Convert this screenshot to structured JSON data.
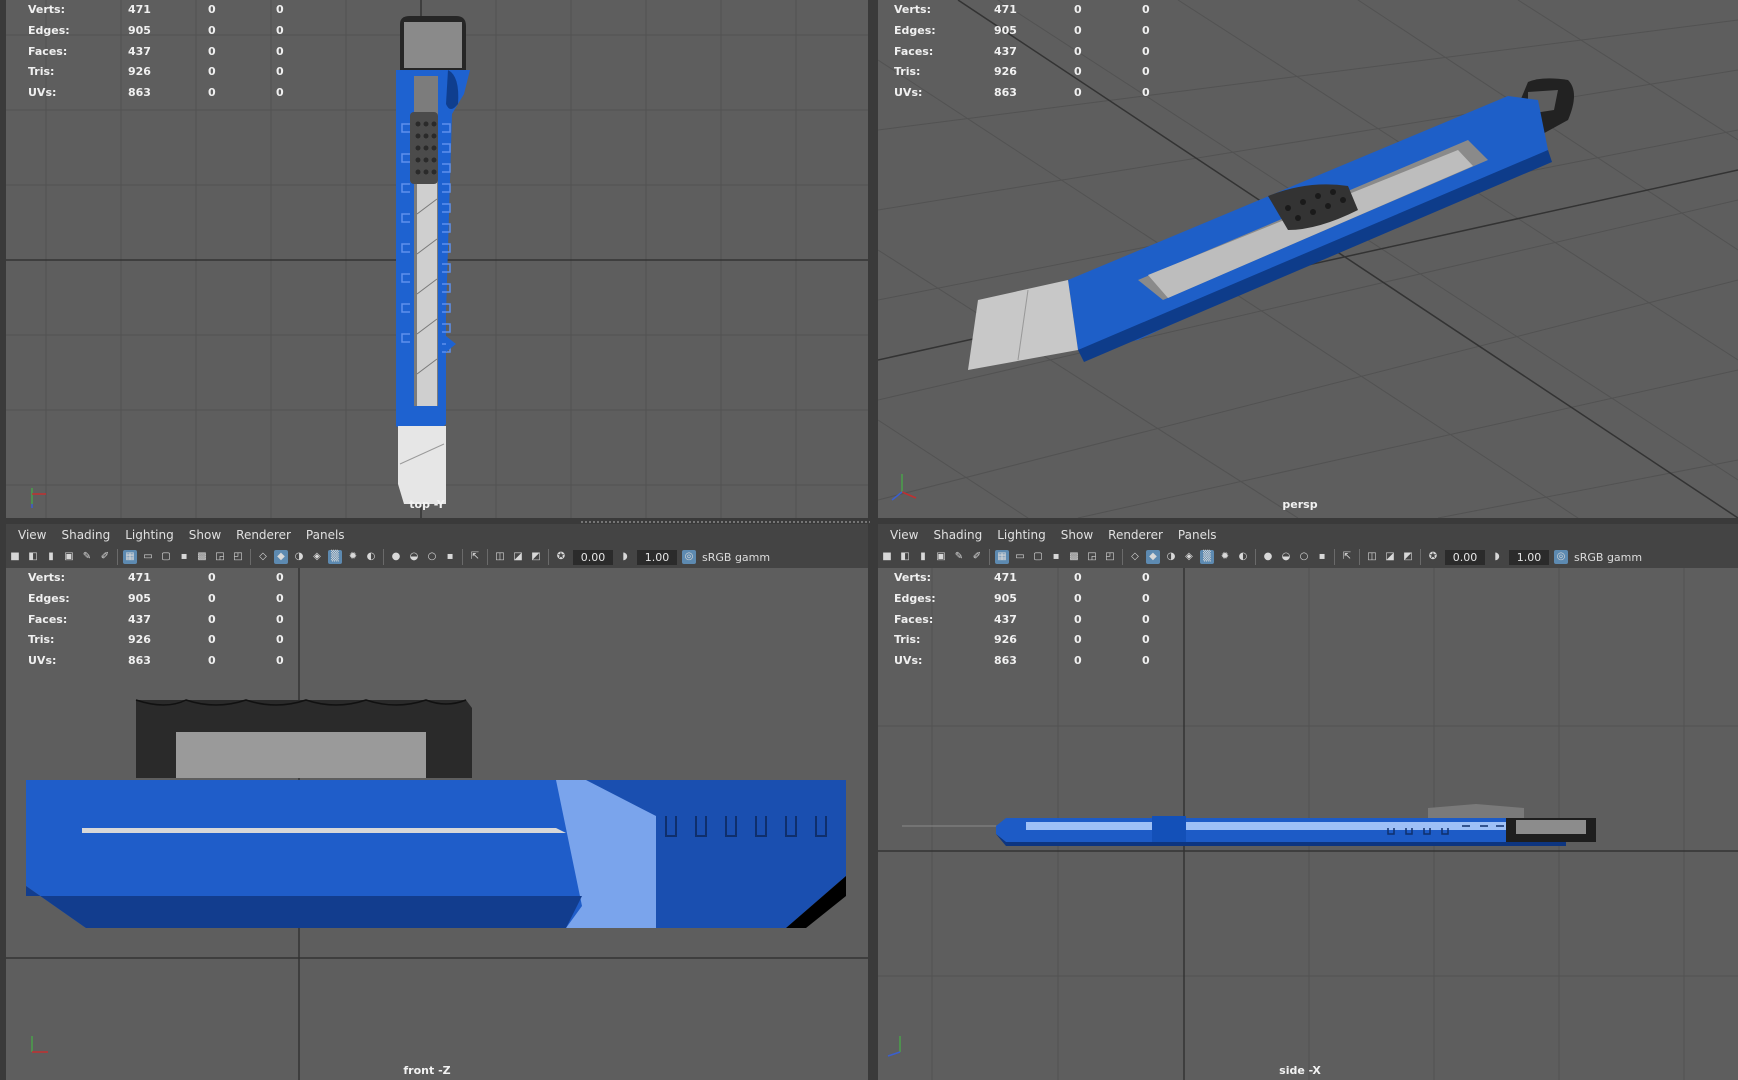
{
  "hud_stats": {
    "rows": [
      {
        "label": "Verts:",
        "a": "471",
        "b": "0",
        "c": "0"
      },
      {
        "label": "Edges:",
        "a": "905",
        "b": "0",
        "c": "0"
      },
      {
        "label": "Faces:",
        "a": "437",
        "b": "0",
        "c": "0"
      },
      {
        "label": "Tris:",
        "a": "926",
        "b": "0",
        "c": "0"
      },
      {
        "label": "UVs:",
        "a": "863",
        "b": "0",
        "c": "0"
      }
    ]
  },
  "viewports": {
    "top_left": {
      "label": "top -Y"
    },
    "top_right": {
      "label": "persp"
    },
    "bottom_left": {
      "label": "front -Z"
    },
    "bottom_right": {
      "label": "side -X"
    }
  },
  "panel_menu": {
    "view": "View",
    "shading": "Shading",
    "lighting": "Lighting",
    "show": "Show",
    "renderer": "Renderer",
    "panels": "Panels"
  },
  "panel_toolbar": {
    "exposure": "0.00",
    "gamma": "1.00",
    "color_space": "sRGB gamm"
  },
  "colors": {
    "viewport_bg": "#5e5e5e",
    "grid_line": "#4f4f4f",
    "grid_axis": "#2f2f2f",
    "knife_blue": "#1e5fc8",
    "blade_grey": "#c8c8c8",
    "accent_selected": "#5d8ab1"
  },
  "icons": [
    "camera-icon",
    "grid-icon",
    "wireframe-icon",
    "smooth-shade-icon",
    "texture-icon",
    "light-icon",
    "isolate-icon",
    "exposure-icon",
    "gamma-icon",
    "colorspace-icon"
  ]
}
